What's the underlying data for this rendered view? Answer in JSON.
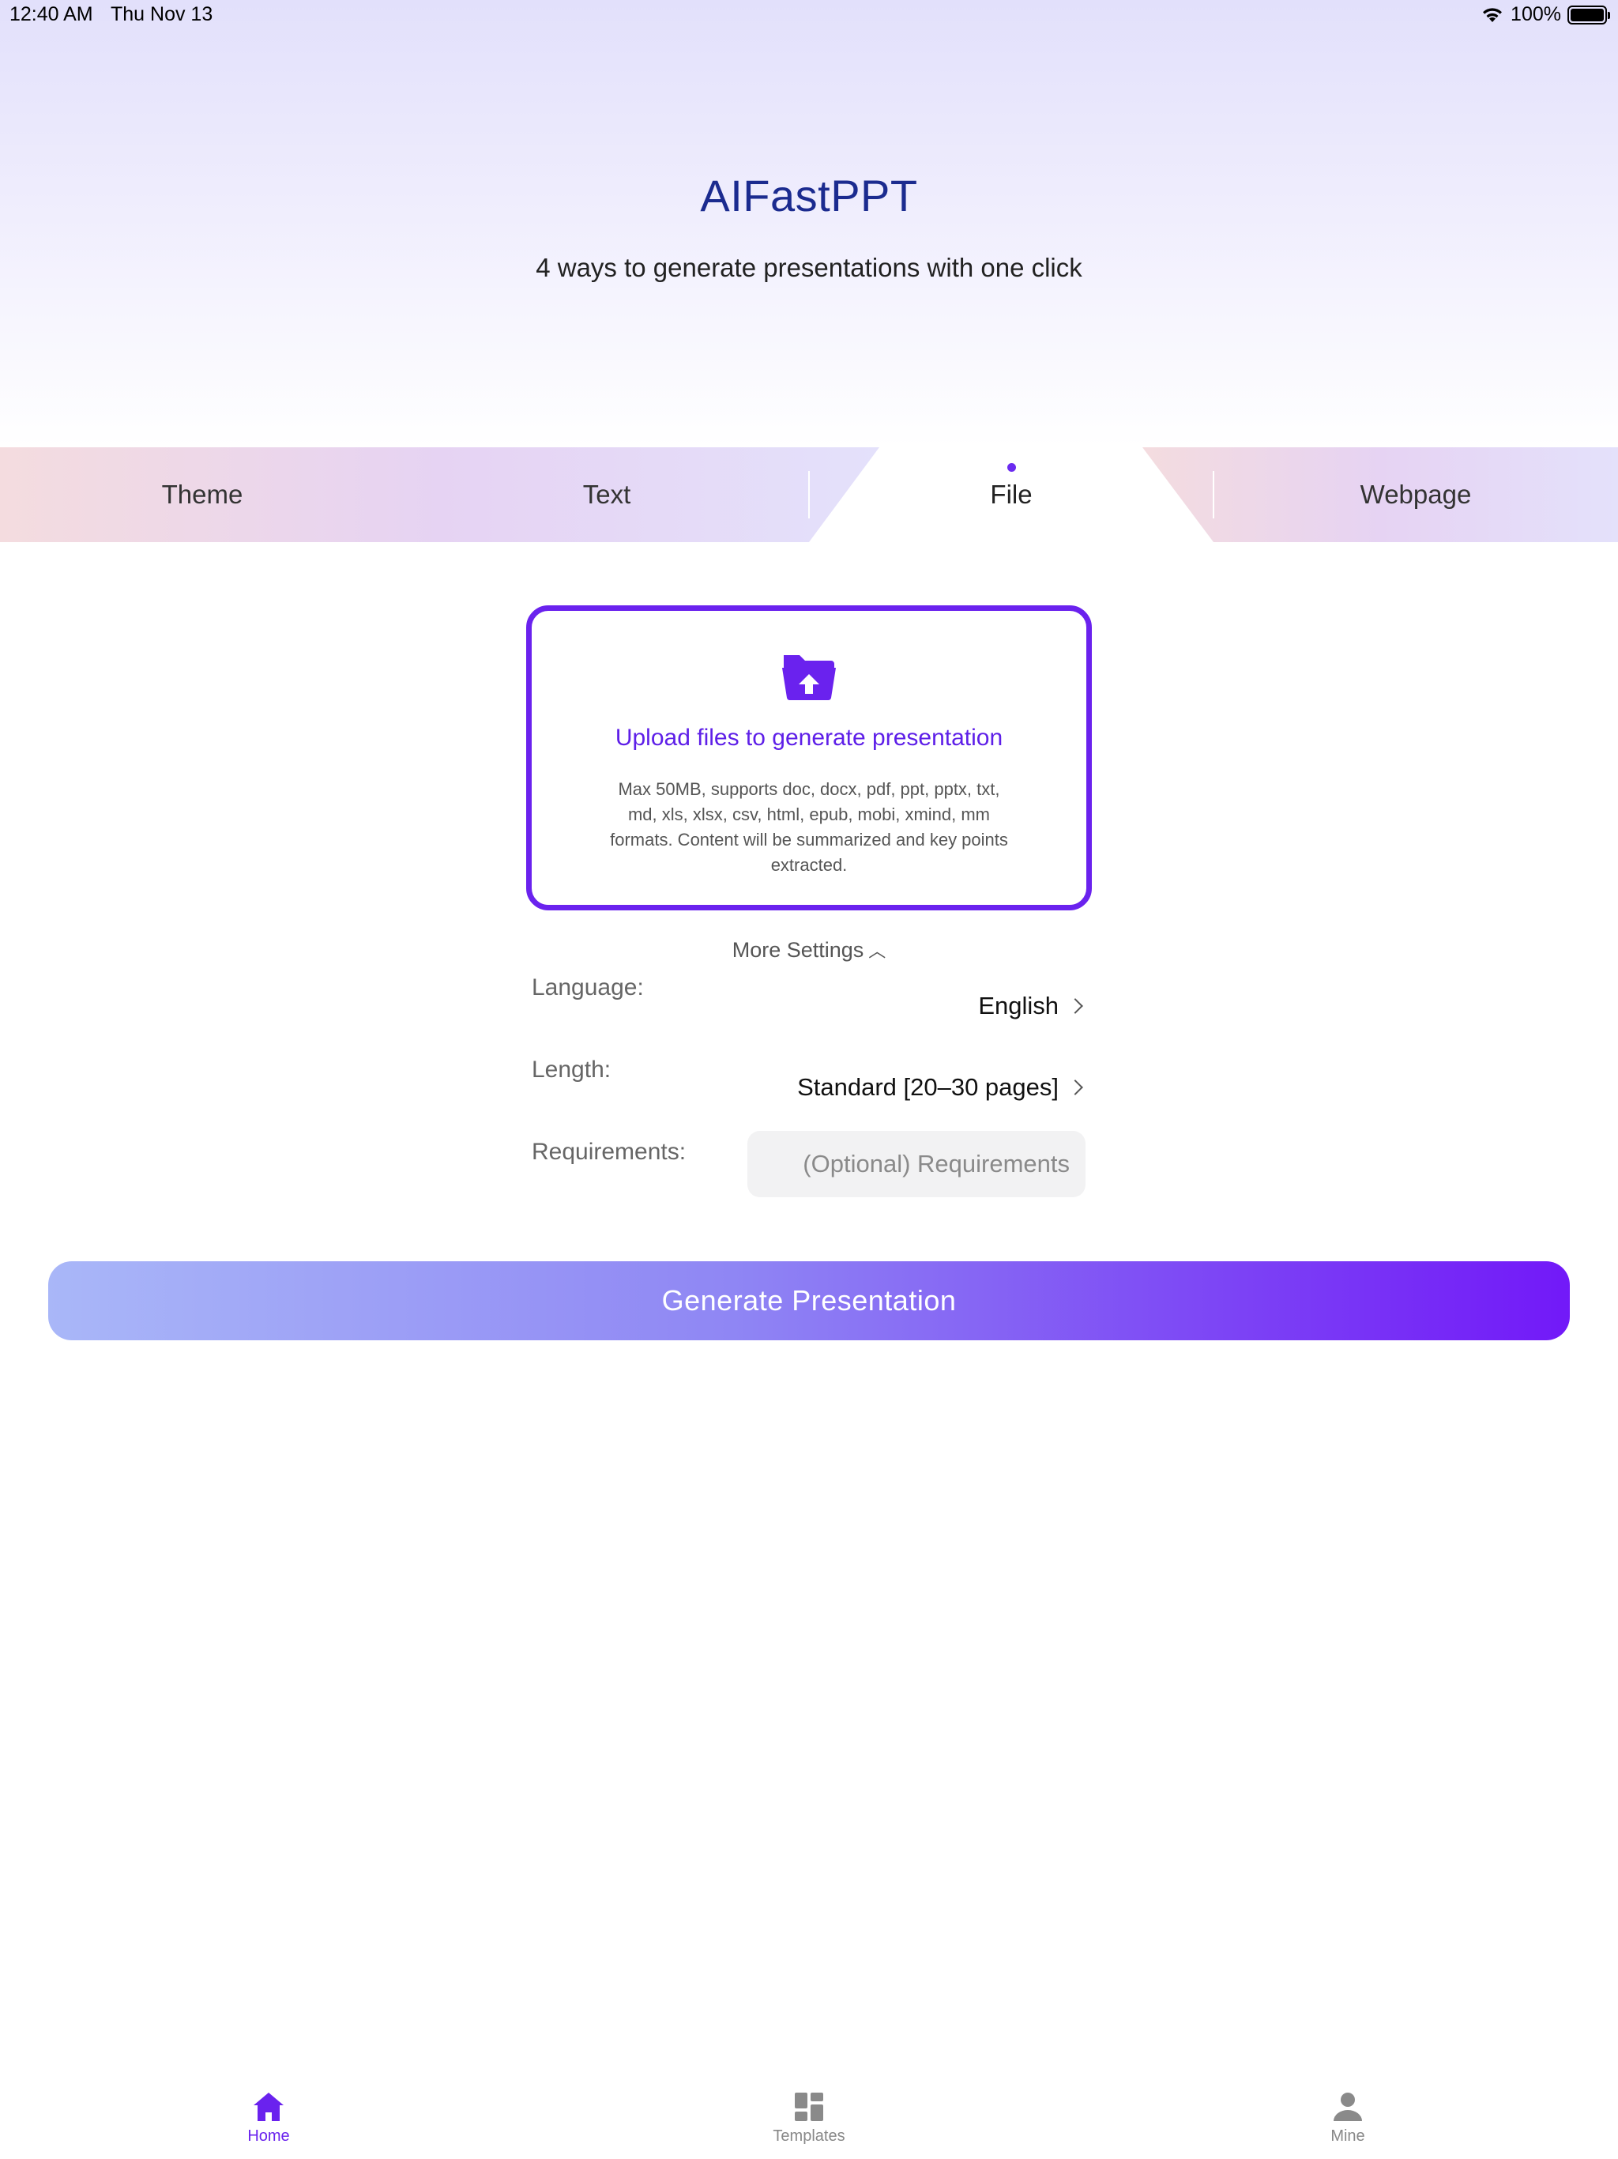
{
  "status_bar": {
    "time": "12:40 AM",
    "date": "Thu Nov 13",
    "battery": "100%"
  },
  "header": {
    "title": "AIFastPPT",
    "subtitle": "4 ways to generate presentations with one click"
  },
  "tabs": [
    {
      "label": "Theme"
    },
    {
      "label": "Text"
    },
    {
      "label": "File",
      "active": true
    },
    {
      "label": "Webpage"
    }
  ],
  "upload": {
    "title": "Upload files to generate presentation",
    "description": "Max 50MB, supports doc, docx, pdf, ppt, pptx, txt, md, xls, xlsx, csv, html, epub, mobi, xmind, mm formats. Content will be summarized and key points extracted."
  },
  "settings": {
    "toggle_label": "More Settings",
    "language": {
      "label": "Language:",
      "value": "English"
    },
    "length": {
      "label": "Length:",
      "value": "Standard [20–30 pages]"
    },
    "requirements": {
      "label": "Requirements:",
      "placeholder": "(Optional) Requirements",
      "value": ""
    }
  },
  "actions": {
    "generate_label": "Generate Presentation"
  },
  "bottom_nav": [
    {
      "label": "Home",
      "icon": "home-icon",
      "active": true
    },
    {
      "label": "Templates",
      "icon": "templates-icon"
    },
    {
      "label": "Mine",
      "icon": "person-icon"
    }
  ],
  "colors": {
    "accent": "#6a22ee",
    "title": "#1b2b8f",
    "button_gradient_start": "#a9b7f8",
    "button_gradient_end": "#7219f8"
  }
}
